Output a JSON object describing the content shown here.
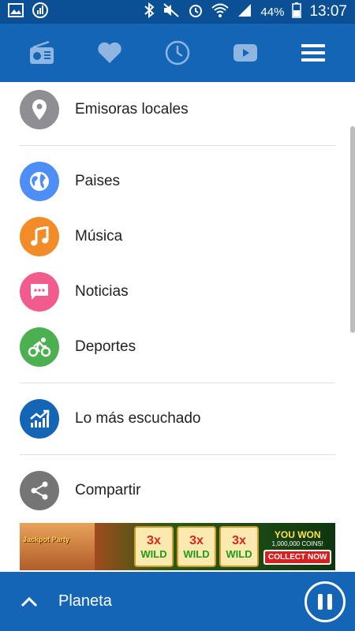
{
  "status_bar": {
    "battery_percent": "44%",
    "time": "13:07"
  },
  "toolbar": {
    "icons": [
      "radio-icon",
      "heart-icon",
      "clock-icon",
      "youtube-icon",
      "menu-icon"
    ]
  },
  "menu": {
    "local": "Emisoras locales",
    "countries": "Paises",
    "music": "Música",
    "news": "Noticias",
    "sports": "Deportes",
    "top": "Lo más escuchado",
    "share": "Compartir"
  },
  "colors": {
    "primary": "#1565b6",
    "status_bar": "#0b4f95",
    "local": "#8e8e93",
    "countries": "#4e8ef7",
    "music": "#f28c28",
    "news": "#f25c8c",
    "sports": "#4caf50",
    "top": "#1565b6",
    "share": "#757575"
  },
  "ad": {
    "logo": "Jackpot Party",
    "reel_multiplier": "3x",
    "reel_text": "WILD",
    "headline": "YOU WON",
    "coins": "1,000,000 COINS!",
    "button": "COLLECT NOW"
  },
  "player": {
    "station": "Planeta"
  }
}
